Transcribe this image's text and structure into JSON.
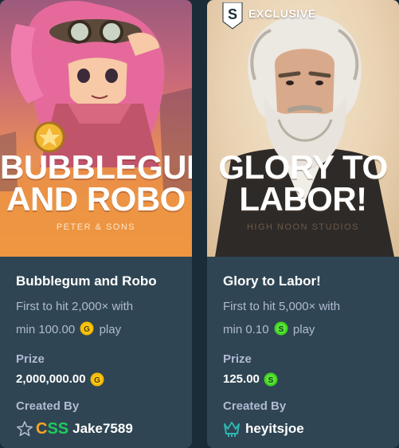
{
  "cards": [
    {
      "art": {
        "title_line1": "Bubblegum",
        "title_line2": "and Robo",
        "studio": "Peter & Sons"
      },
      "title": "Bubblegum and Robo",
      "desc_part1": "First to hit 2,000× with",
      "desc_part2": "min 100.00",
      "desc_part3": "play",
      "bet_currency_icon": "gold-coin-icon",
      "prize_label": "Prize",
      "prize_value": "2,000,000.00",
      "prize_currency_icon": "gold-coin-icon",
      "created_by_label": "Created By",
      "creator_badge_icon": "star-outline-icon",
      "creator_tag": [
        "C",
        "S",
        "S"
      ],
      "creator_name": "Jake7589"
    },
    {
      "art": {
        "badge": "S",
        "exclusive_label": "EXCLUSIVE",
        "title_line1": "Glory to",
        "title_line2": "Labor!",
        "studio": "High Noon Studios"
      },
      "title": "Glory to Labor!",
      "desc_part1": "First to hit 5,000× with",
      "desc_part2": "min 0.10",
      "desc_part3": "play",
      "bet_currency_icon": "sweeps-coin-icon",
      "prize_label": "Prize",
      "prize_value": "125.00",
      "prize_currency_icon": "sweeps-coin-icon",
      "created_by_label": "Created By",
      "creator_badge_icon": "vip-crown-icon",
      "creator_name": "heyitsjoe"
    }
  ],
  "colors": {
    "card_bg": "#2f4553",
    "page_bg": "#1a2c38",
    "muted_text": "#b1bad3",
    "gold_coin": "#f5b800",
    "sweeps_coin": "#3bd31e",
    "vip_teal": "#2fb5b0"
  }
}
